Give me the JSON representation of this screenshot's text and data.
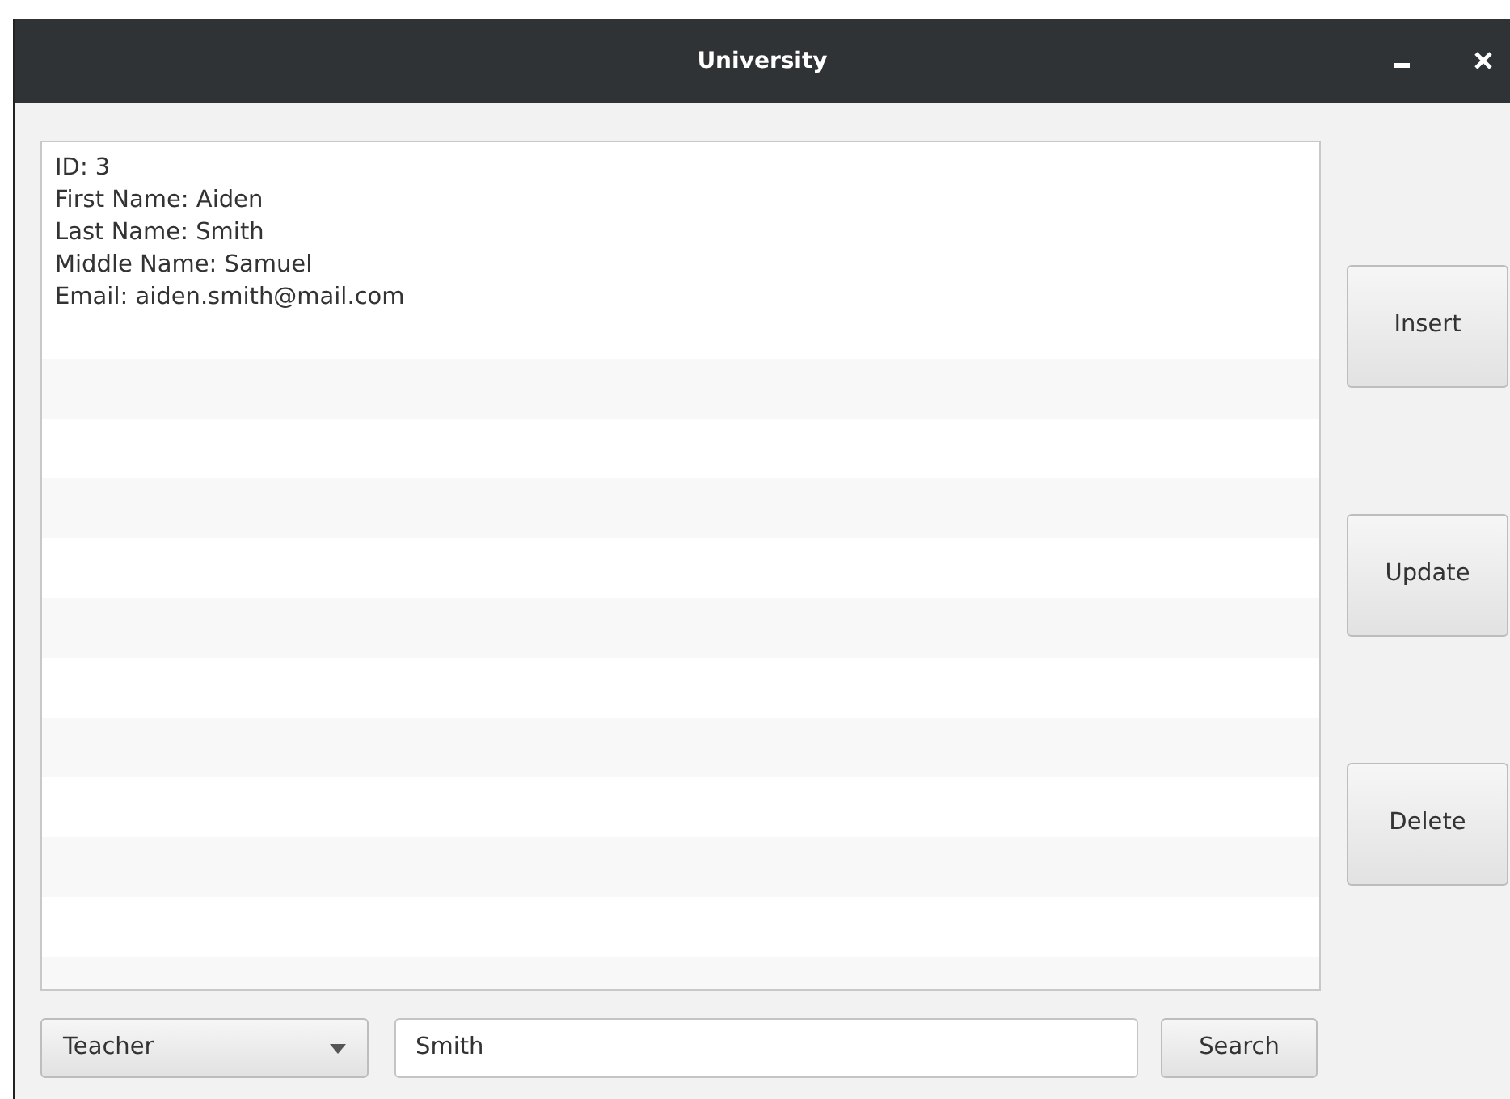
{
  "window": {
    "title": "University"
  },
  "list": {
    "items": [
      {
        "lines": [
          "ID: 3",
          "First Name: Aiden",
          "Last Name: Smith",
          "Middle Name: Samuel",
          "Email: aiden.smith@mail.com"
        ]
      }
    ]
  },
  "side_buttons": [
    "Insert",
    "Update",
    "Delete"
  ],
  "search_bar": {
    "category": "Teacher",
    "query": "Smith",
    "button": "Search"
  }
}
